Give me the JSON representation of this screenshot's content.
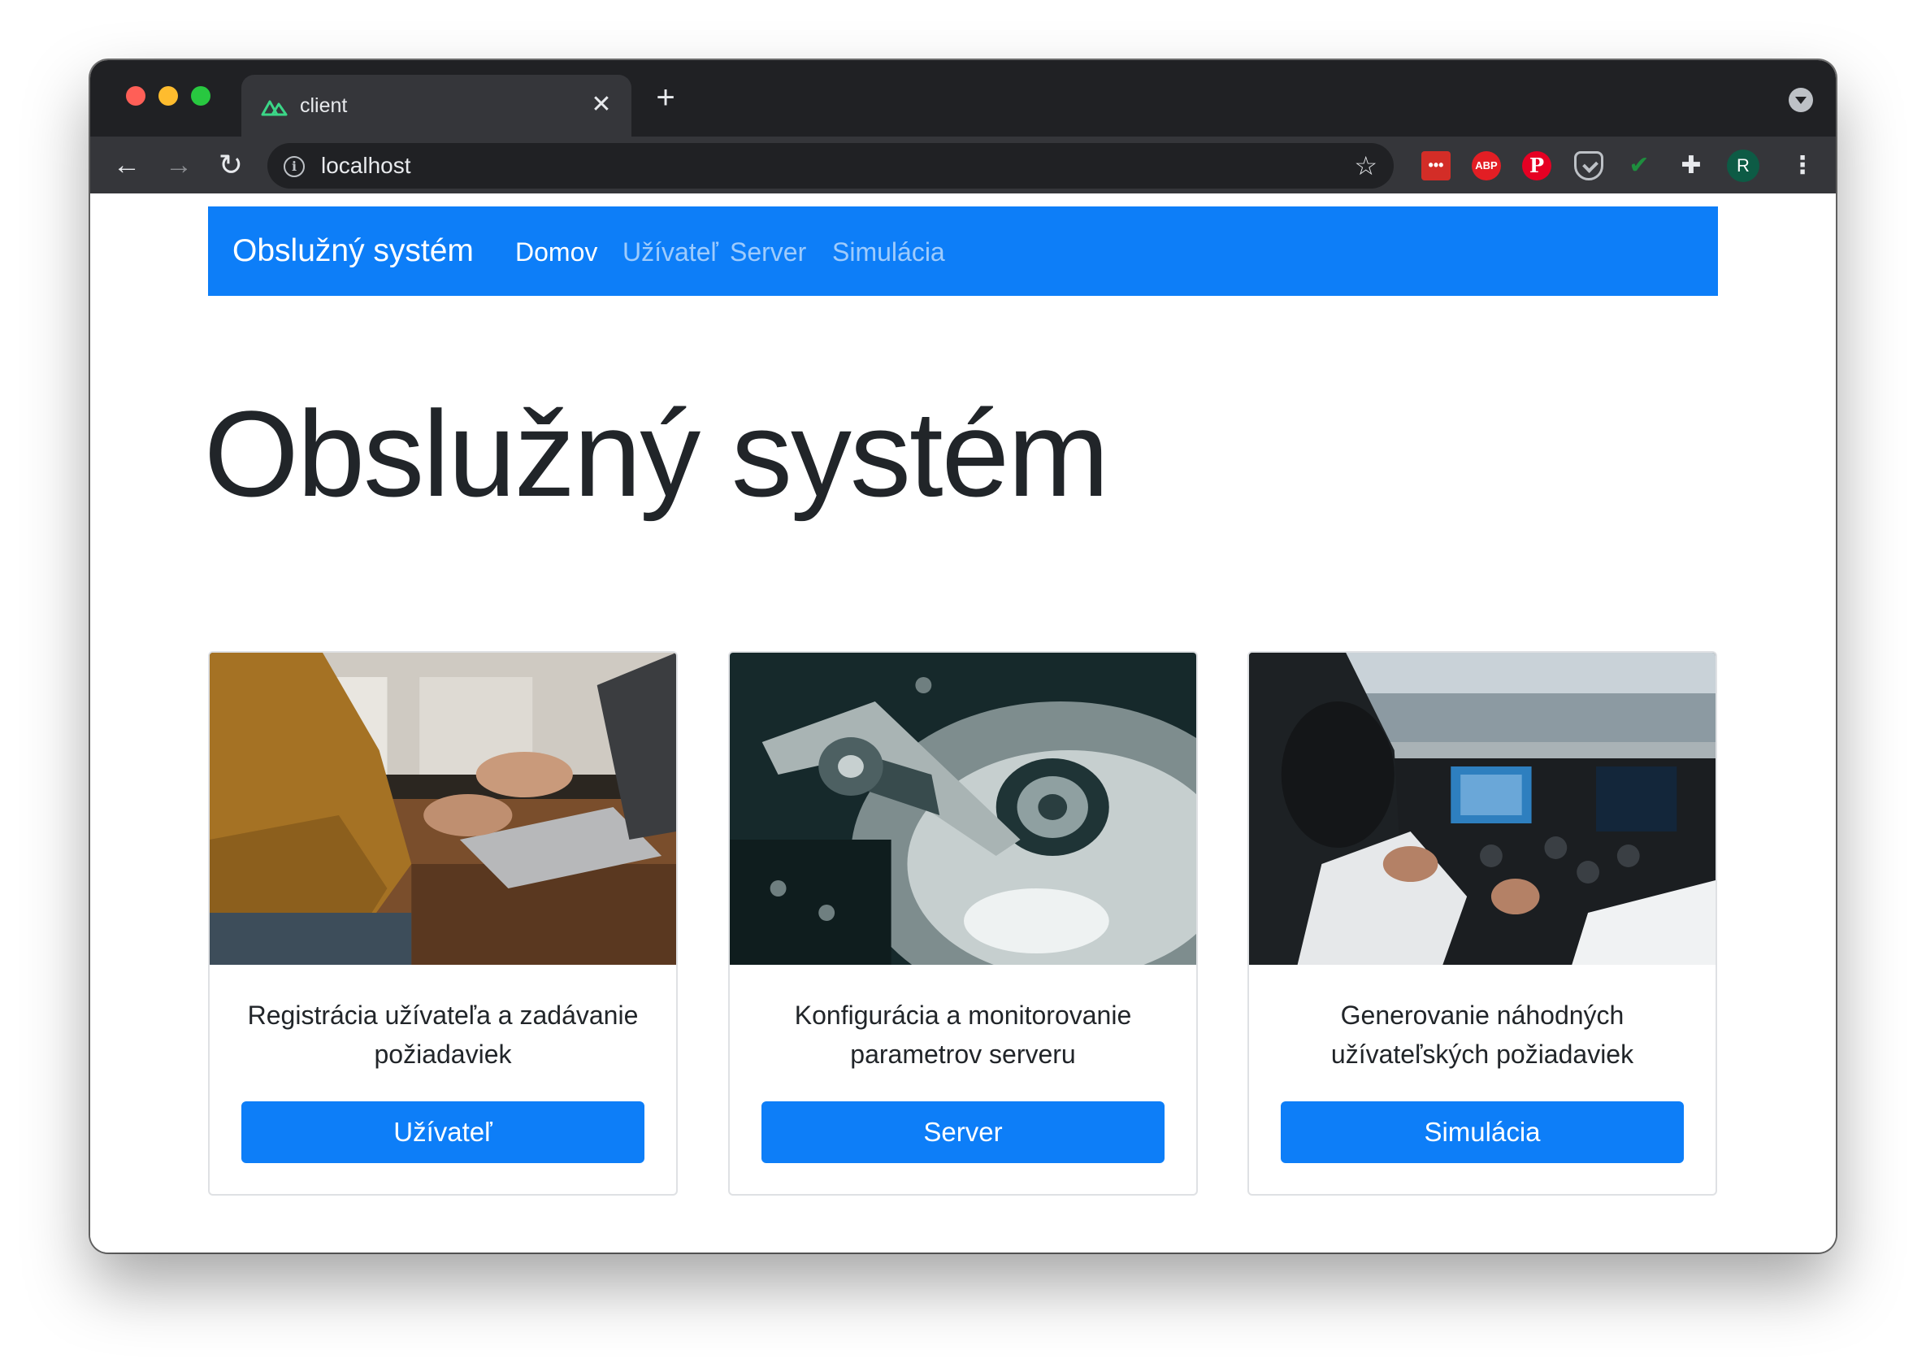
{
  "browser": {
    "tab": {
      "title": "client",
      "favicon": "nuxt-logo-icon"
    },
    "address_bar": {
      "url": "localhost"
    },
    "extensions": {
      "lastpass": "•••",
      "adblock": "ABP",
      "pinterest": "P",
      "avatar": "R"
    },
    "icons": {
      "close": "✕",
      "new_tab": "+",
      "back": "←",
      "forward": "→",
      "reload": "↻",
      "info": "i",
      "star": "☆",
      "check": "✔",
      "puzzle": "✚",
      "menu": "⋮"
    }
  },
  "navbar": {
    "brand": "Obslužný systém",
    "links": [
      {
        "label": "Domov",
        "active": true
      },
      {
        "label": "Užívateľ",
        "active": false
      },
      {
        "label": "Server",
        "active": false
      },
      {
        "label": "Simulácia",
        "active": false
      }
    ]
  },
  "hero": {
    "title": "Obslužný systém"
  },
  "cards": [
    {
      "image": "laptop-typing-photo",
      "text": "Registrácia užívateľa a zadávanie požiadaviek",
      "button": "Užívateľ"
    },
    {
      "image": "hard-drive-photo",
      "text": "Konfigurácia a monitorovanie parametrov serveru",
      "button": "Server"
    },
    {
      "image": "airplane-cockpit-photo",
      "text": "Generovanie náhodných užívateľských požiadaviek",
      "button": "Simulácia"
    }
  ],
  "colors": {
    "primary": "#0d7ef8",
    "chrome_dark": "#202124",
    "chrome_toolbar": "#35363a",
    "text": "#212529"
  }
}
